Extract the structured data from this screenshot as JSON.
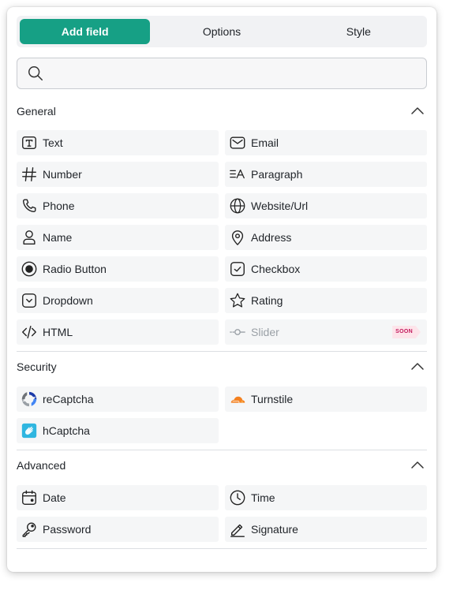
{
  "tabs": [
    {
      "label": "Add field",
      "active": true
    },
    {
      "label": "Options",
      "active": false
    },
    {
      "label": "Style",
      "active": false
    }
  ],
  "search": {
    "placeholder": "",
    "value": ""
  },
  "sections": {
    "general": {
      "title": "General",
      "items": {
        "text": "Text",
        "email": "Email",
        "number": "Number",
        "paragraph": "Paragraph",
        "phone": "Phone",
        "website": "Website/Url",
        "name": "Name",
        "address": "Address",
        "radio": "Radio Button",
        "checkbox": "Checkbox",
        "dropdown": "Dropdown",
        "rating": "Rating",
        "html": "HTML",
        "slider": "Slider"
      },
      "slider_badge": "SOON"
    },
    "security": {
      "title": "Security",
      "items": {
        "recaptcha": "reCaptcha",
        "turnstile": "Turnstile",
        "hcaptcha": "hCaptcha"
      }
    },
    "advanced": {
      "title": "Advanced",
      "items": {
        "date": "Date",
        "time": "Time",
        "password": "Password",
        "signature": "Signature"
      }
    }
  },
  "colors": {
    "accent": "#16a085",
    "badge_bg": "#fde4ea",
    "badge_text": "#c2185b",
    "turnstile": "#f48120",
    "hcaptcha": "#2fb6e0"
  }
}
